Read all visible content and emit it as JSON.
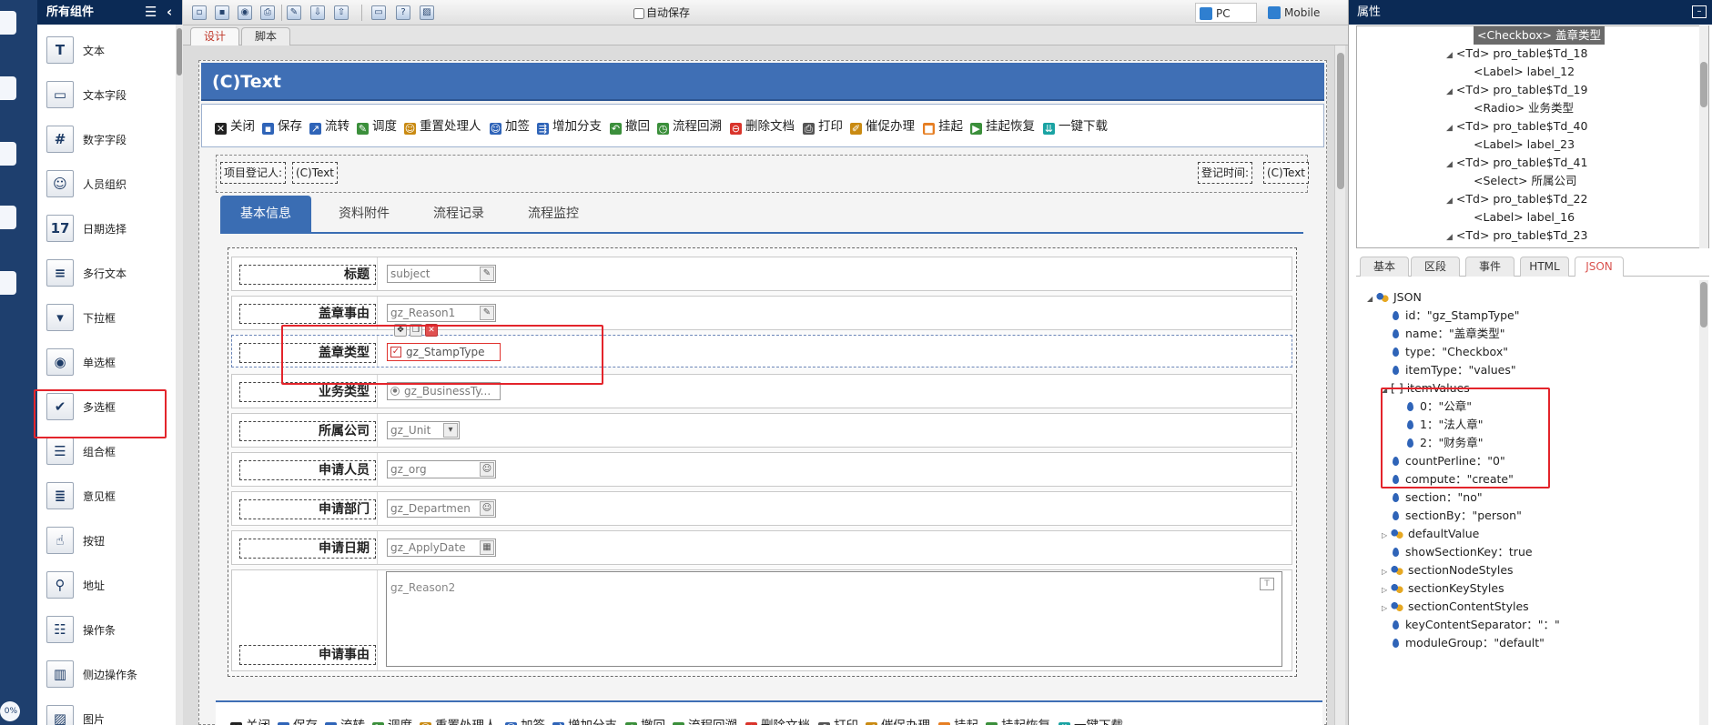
{
  "palette": {
    "title": "所有组件",
    "items": [
      {
        "label": "文本",
        "icon": "text-T-icon",
        "glyph": "T"
      },
      {
        "label": "文本字段",
        "icon": "text-field-icon",
        "glyph": "▭"
      },
      {
        "label": "数字字段",
        "icon": "number-field-icon",
        "glyph": "#"
      },
      {
        "label": "人员组织",
        "icon": "user-org-icon",
        "glyph": "☺"
      },
      {
        "label": "日期选择",
        "icon": "calendar-icon",
        "glyph": "17"
      },
      {
        "label": "多行文本",
        "icon": "multiline-text-icon",
        "glyph": "≡"
      },
      {
        "label": "下拉框",
        "icon": "dropdown-icon",
        "glyph": "▾"
      },
      {
        "label": "单选框",
        "icon": "radio-icon",
        "glyph": "◉"
      },
      {
        "label": "多选框",
        "icon": "checkbox-icon",
        "glyph": "✔"
      },
      {
        "label": "组合框",
        "icon": "combobox-icon",
        "glyph": "☰"
      },
      {
        "label": "意见框",
        "icon": "opinion-icon",
        "glyph": "≣"
      },
      {
        "label": "按钮",
        "icon": "hand-pointer-icon",
        "glyph": "☝"
      },
      {
        "label": "地址",
        "icon": "map-pin-icon",
        "glyph": "⚲"
      },
      {
        "label": "操作条",
        "icon": "action-bar-icon",
        "glyph": "☷"
      },
      {
        "label": "侧边操作条",
        "icon": "side-action-bar-icon",
        "glyph": "▥"
      },
      {
        "label": "图片",
        "icon": "image-icon",
        "glyph": "▨"
      }
    ]
  },
  "toolbar": {
    "autosave_label": "自动保存",
    "pc_label": "PC",
    "mobile_label": "Mobile"
  },
  "design_tabs": [
    {
      "label": "设计",
      "active": true
    },
    {
      "label": "脚本",
      "active": false
    }
  ],
  "form": {
    "title": "(C)Text",
    "actions": [
      {
        "label": "关闭",
        "icon": "close-icon",
        "glyph": "✕",
        "color": "#222222"
      },
      {
        "label": "保存",
        "icon": "save-icon",
        "glyph": "▪",
        "color": "#2f64b8"
      },
      {
        "label": "流转",
        "icon": "flow-icon",
        "glyph": "↗",
        "color": "#2f64b8"
      },
      {
        "label": "调度",
        "icon": "schedule-icon",
        "glyph": "✎",
        "color": "#3b8f3b"
      },
      {
        "label": "重置处理人",
        "icon": "reset-handler-icon",
        "glyph": "☺",
        "color": "#c98a12"
      },
      {
        "label": "加签",
        "icon": "add-sign-icon",
        "glyph": "☺",
        "color": "#2f64b8"
      },
      {
        "label": "增加分支",
        "icon": "add-branch-icon",
        "glyph": "⇶",
        "color": "#2f64b8"
      },
      {
        "label": "撤回",
        "icon": "undo-icon",
        "glyph": "↶",
        "color": "#3b8f3b"
      },
      {
        "label": "流程回溯",
        "icon": "flow-trace-icon",
        "glyph": "◷",
        "color": "#3b8f3b"
      },
      {
        "label": "删除文档",
        "icon": "delete-doc-icon",
        "glyph": "⊖",
        "color": "#d9342b"
      },
      {
        "label": "打印",
        "icon": "print-icon",
        "glyph": "⎙",
        "color": "#555555"
      },
      {
        "label": "催促办理",
        "icon": "urge-icon",
        "glyph": "✐",
        "color": "#c98a12"
      },
      {
        "label": "挂起",
        "icon": "suspend-icon",
        "glyph": "■",
        "color": "#e67e22"
      },
      {
        "label": "挂起恢复",
        "icon": "resume-icon",
        "glyph": "▶",
        "color": "#3b8f3b"
      },
      {
        "label": "一键下载",
        "icon": "download-icon",
        "glyph": "⇊",
        "color": "#1aa3a3"
      }
    ],
    "registrant_label": "项目登记人:",
    "registrant_value": "(C)Text",
    "reg_time_label": "登记时间:",
    "reg_time_value": "(C)Text",
    "tabs": [
      {
        "label": "基本信息",
        "active": true
      },
      {
        "label": "资料附件",
        "active": false
      },
      {
        "label": "流程记录",
        "active": false
      },
      {
        "label": "流程监控",
        "active": false
      }
    ],
    "fields": [
      {
        "label": "标题",
        "control": "subject",
        "btn": "✎"
      },
      {
        "label": "盖章事由",
        "control": "gz_Reason1",
        "btn": "✎"
      },
      {
        "label": "盖章类型",
        "control": "gz_StampType",
        "btn": ""
      },
      {
        "label": "业务类型",
        "control": "gz_BusinessTy...",
        "btn": ""
      },
      {
        "label": "所属公司",
        "control": "gz_Unit",
        "btn": "▾"
      },
      {
        "label": "申请人员",
        "control": "gz_org",
        "btn": "☺"
      },
      {
        "label": "申请部门",
        "control": "gz_Departmen",
        "btn": "☺"
      },
      {
        "label": "申请日期",
        "control": "gz_ApplyDate",
        "btn": "▦"
      },
      {
        "label": "申请事由",
        "control": "gz_Reason2",
        "btn": "T"
      }
    ]
  },
  "props": {
    "title": "属性",
    "tree": [
      {
        "text": "<Checkbox> 盖章类型",
        "selected": true,
        "arrow": false
      },
      {
        "text": "<Td> pro_table$Td_18",
        "selected": false,
        "arrow": true
      },
      {
        "text": "<Label> label_12",
        "selected": false,
        "arrow": false
      },
      {
        "text": "<Td> pro_table$Td_19",
        "selected": false,
        "arrow": true
      },
      {
        "text": "<Radio> 业务类型",
        "selected": false,
        "arrow": false
      },
      {
        "text": "<Td> pro_table$Td_40",
        "selected": false,
        "arrow": true
      },
      {
        "text": "<Label> label_23",
        "selected": false,
        "arrow": false
      },
      {
        "text": "<Td> pro_table$Td_41",
        "selected": false,
        "arrow": true
      },
      {
        "text": "<Select> 所属公司",
        "selected": false,
        "arrow": false
      },
      {
        "text": "<Td> pro_table$Td_22",
        "selected": false,
        "arrow": true
      },
      {
        "text": "<Label> label_16",
        "selected": false,
        "arrow": false
      },
      {
        "text": "<Td> pro_table$Td_23",
        "selected": false,
        "arrow": true
      }
    ],
    "tabs": [
      "基本",
      "区段",
      "事件",
      "HTML",
      "JSON"
    ],
    "json": [
      {
        "text": "JSON",
        "kind": "obj",
        "tri": "◢",
        "level": 0
      },
      {
        "text": "id：\"gz_StampType\"",
        "kind": "dot",
        "tri": "",
        "level": 1
      },
      {
        "text": "name：\"盖章类型\"",
        "kind": "dot",
        "tri": "",
        "level": 1
      },
      {
        "text": "type：\"Checkbox\"",
        "kind": "dot",
        "tri": "",
        "level": 1
      },
      {
        "text": "itemType：\"values\"",
        "kind": "dot",
        "tri": "",
        "level": 1
      },
      {
        "text": "[ ]  itemValues",
        "kind": "arr",
        "tri": "◢",
        "level": 1
      },
      {
        "text": "0：\"公章\"",
        "kind": "dot",
        "tri": "",
        "level": 2
      },
      {
        "text": "1：\"法人章\"",
        "kind": "dot",
        "tri": "",
        "level": 2
      },
      {
        "text": "2：\"财务章\"",
        "kind": "dot",
        "tri": "",
        "level": 2
      },
      {
        "text": "countPerline：\"0\"",
        "kind": "dot",
        "tri": "",
        "level": 1
      },
      {
        "text": "compute：\"create\"",
        "kind": "dot",
        "tri": "",
        "level": 1
      },
      {
        "text": "section：\"no\"",
        "kind": "dot",
        "tri": "",
        "level": 1
      },
      {
        "text": "sectionBy：\"person\"",
        "kind": "dot",
        "tri": "",
        "level": 1
      },
      {
        "text": "defaultValue",
        "kind": "obj",
        "tri": "▷",
        "level": 1
      },
      {
        "text": "showSectionKey：true",
        "kind": "dot",
        "tri": "",
        "level": 1
      },
      {
        "text": "sectionNodeStyles",
        "kind": "obj",
        "tri": "▷",
        "level": 1
      },
      {
        "text": "sectionKeyStyles",
        "kind": "obj",
        "tri": "▷",
        "level": 1
      },
      {
        "text": "sectionContentStyles",
        "kind": "obj",
        "tri": "▷",
        "level": 1
      },
      {
        "text": "keyContentSeparator：\"：\"",
        "kind": "dot",
        "tri": "",
        "level": 1
      },
      {
        "text": "moduleGroup：\"default\"",
        "kind": "dot",
        "tri": "",
        "level": 1
      }
    ]
  },
  "colors": {
    "header_navy": "#0b2a55",
    "form_title_blue": "#3f6fb5",
    "highlight_red": "#e3242b"
  }
}
